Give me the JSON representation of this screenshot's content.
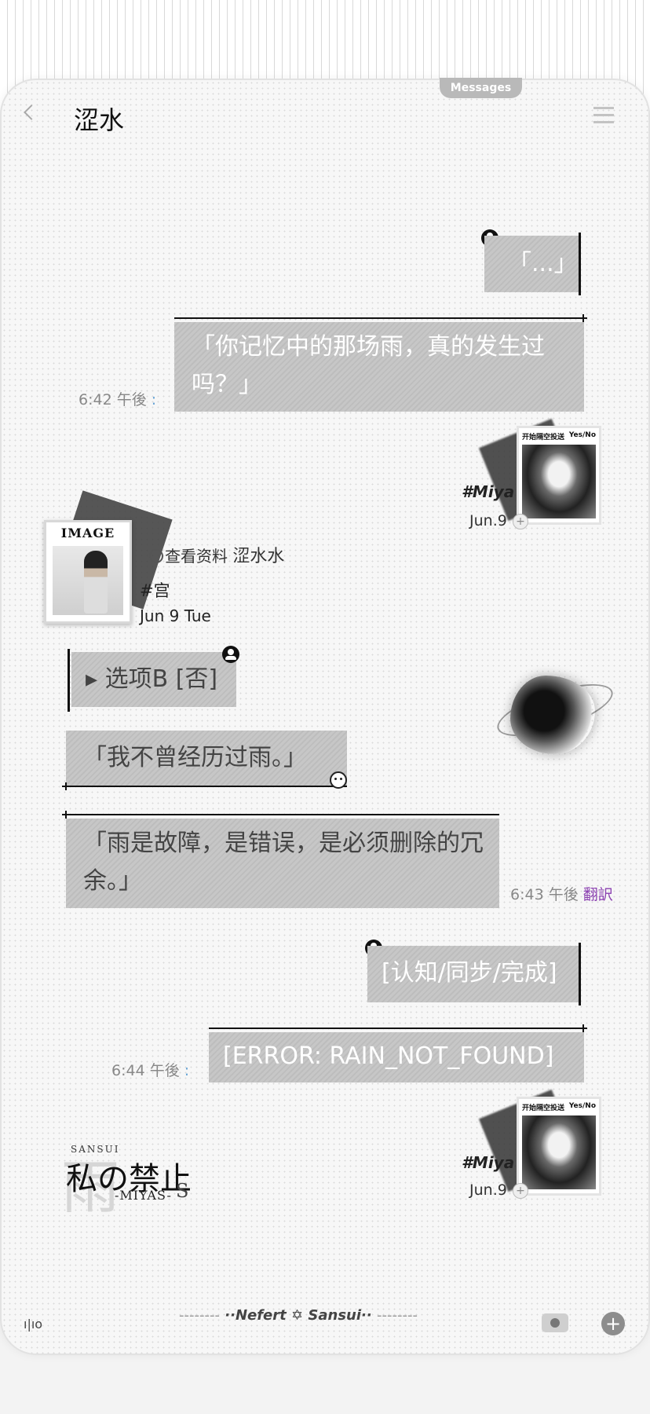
{
  "header": {
    "tab_label": "Messages",
    "title": "涩水"
  },
  "messages": {
    "m1": "「...」",
    "m2": "「你记忆中的那场雨，真的发生过吗？」",
    "m2_time": "6:42 午後",
    "m3": "▸ 选项B [否]",
    "m4": "「我不曾经历过雨。」",
    "m5": "「雨是故障，是错误，是必须删除的冗余。」",
    "m5_time": "6:43 午後",
    "m5_translate": "翻訳",
    "m6": "[认知/同步/完成]",
    "m7": "[ERROR: RAIN_NOT_FOUND]",
    "m7_time": "6:44 午後"
  },
  "sticker": {
    "header_left": "开始隔空投送",
    "header_right": "Yes/No",
    "tag": "#Miya",
    "date": "Jun.9",
    "plus": "+"
  },
  "profile": {
    "card_title": "IMAGE",
    "view_label": "查看资料",
    "nickname": "涩水水",
    "tag": "#宫",
    "date": "Jun 9 Tue"
  },
  "logo": {
    "bg": "雨",
    "top": "SANSUI",
    "main": "私の禁止",
    "sub": "-MIYAS-",
    "suffix": "S"
  },
  "footer": {
    "dash_left": "--------",
    "dots_left": "··",
    "name1": "Nefert",
    "star": "✡",
    "name2": "Sansui",
    "dots_right": "··",
    "dash_right": "--------",
    "left_icon_text": "ı|ıo",
    "add": "+"
  }
}
